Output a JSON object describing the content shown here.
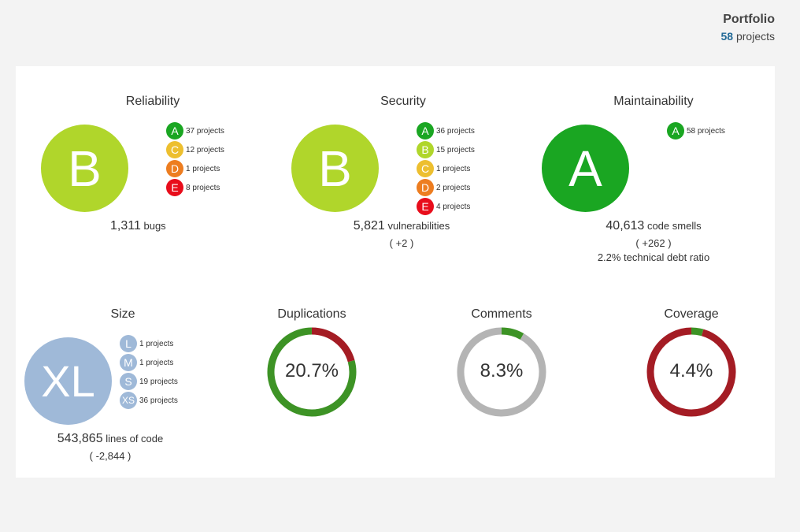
{
  "portfolio": {
    "title": "Portfolio",
    "project_count": "58",
    "project_suffix": "projects"
  },
  "colors": {
    "A": "#1aa622",
    "B": "#b0d62b",
    "C": "#edbf2f",
    "D": "#ed7d20",
    "E": "#e80d1b",
    "size": "#9fb9d8",
    "dup_green": "#3d9325",
    "dup_red": "#a41c24",
    "gray": "#b4b4b4"
  },
  "reliability": {
    "title": "Reliability",
    "rating": "B",
    "breakdown": [
      {
        "grade": "A",
        "text": "37 projects"
      },
      {
        "grade": "C",
        "text": "12 projects"
      },
      {
        "grade": "D",
        "text": "1 projects"
      },
      {
        "grade": "E",
        "text": "8 projects"
      }
    ],
    "value": "1,311",
    "unit": "bugs"
  },
  "security": {
    "title": "Security",
    "rating": "B",
    "breakdown": [
      {
        "grade": "A",
        "text": "36 projects"
      },
      {
        "grade": "B",
        "text": "15 projects"
      },
      {
        "grade": "C",
        "text": "1 projects"
      },
      {
        "grade": "D",
        "text": "2 projects"
      },
      {
        "grade": "E",
        "text": "4 projects"
      }
    ],
    "value": "5,821",
    "unit": "vulnerabilities",
    "delta": "( +2 )"
  },
  "maintainability": {
    "title": "Maintainability",
    "rating": "A",
    "breakdown": [
      {
        "grade": "A",
        "text": "58 projects"
      }
    ],
    "value": "40,613",
    "unit": "code smells",
    "delta": "( +262 )",
    "debt_ratio": "2.2% technical debt ratio"
  },
  "size": {
    "title": "Size",
    "rating": "XL",
    "breakdown": [
      {
        "grade": "L",
        "text": "1 projects"
      },
      {
        "grade": "M",
        "text": "1 projects"
      },
      {
        "grade": "S",
        "text": "19 projects"
      },
      {
        "grade": "XS",
        "text": "36 projects"
      }
    ],
    "value": "543,865",
    "unit": "lines of code",
    "delta": "( -2,844 )"
  },
  "duplications": {
    "title": "Duplications",
    "label": "20.7%",
    "fraction": 0.207
  },
  "comments": {
    "title": "Comments",
    "label": "8.3%",
    "fraction": 0.083
  },
  "coverage": {
    "title": "Coverage",
    "label": "4.4%",
    "fraction": 0.044
  }
}
